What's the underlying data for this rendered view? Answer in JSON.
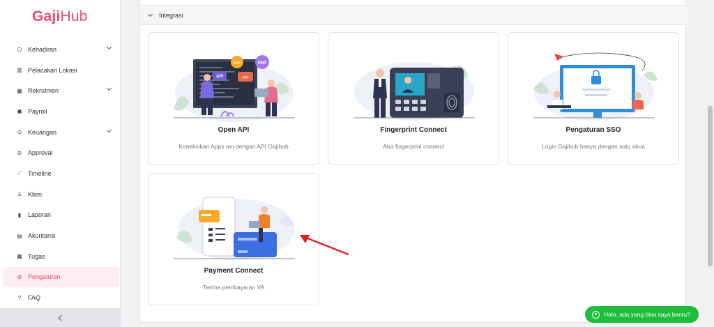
{
  "brand": {
    "logo_bold": "Gaji",
    "logo_light": "Hub",
    "color": "#e84a6f"
  },
  "sidebar": {
    "items": [
      {
        "label": "Kehadiran",
        "icon": "clock-icon",
        "glyph": "◷",
        "expandable": true
      },
      {
        "label": "Pelacakan Lokasi",
        "icon": "map-icon",
        "glyph": "▥",
        "expandable": false
      },
      {
        "label": "Rekrutmen",
        "icon": "grid-icon",
        "glyph": "▦",
        "expandable": true
      },
      {
        "label": "Payroll",
        "icon": "payroll-icon",
        "glyph": "▣",
        "expandable": false
      },
      {
        "label": "Keuangan",
        "icon": "money-icon",
        "glyph": "⊙",
        "expandable": true
      },
      {
        "label": "Approval",
        "icon": "check-circle-icon",
        "glyph": "⊘",
        "expandable": false
      },
      {
        "label": "Timeline",
        "icon": "trend-icon",
        "glyph": "⟋",
        "expandable": false
      },
      {
        "label": "Klien",
        "icon": "client-icon",
        "glyph": "♙",
        "expandable": false
      },
      {
        "label": "Laporan",
        "icon": "bar-chart-icon",
        "glyph": "▮",
        "expandable": false
      },
      {
        "label": "Akuntansi",
        "icon": "book-icon",
        "glyph": "▤",
        "expandable": false
      },
      {
        "label": "Tugas",
        "icon": "calendar-icon",
        "glyph": "▦",
        "expandable": false
      },
      {
        "label": "Pengaturan",
        "icon": "gear-icon",
        "glyph": "⚙",
        "expandable": false,
        "active": true
      },
      {
        "label": "FAQ",
        "icon": "question-icon",
        "glyph": "?",
        "expandable": false
      }
    ],
    "collapse_icon": "chevron-left-icon"
  },
  "section": {
    "title": "Integrasi",
    "expanded": true
  },
  "cards": [
    {
      "title": "Open API",
      "description": "Koneksikan Apps mu dengan API Gajihub",
      "badges": [
        "API",
        "C++",
        "PHP",
        "</>"
      ]
    },
    {
      "title": "Fingerprint Connect",
      "description": "Atur fingerprint connect"
    },
    {
      "title": "Pengaturan SSO",
      "description": "Login Gajihub hanya dengan satu akun"
    },
    {
      "title": "Payment Connect",
      "description": "Terima pembayaran VA"
    }
  ],
  "chat": {
    "label": "Halo, ada yang bisa saya bantu?",
    "icon": "whatsapp-icon",
    "color": "#1fbd3b"
  },
  "annotation": {
    "color": "#e02020",
    "points_to": "Payment Connect"
  }
}
